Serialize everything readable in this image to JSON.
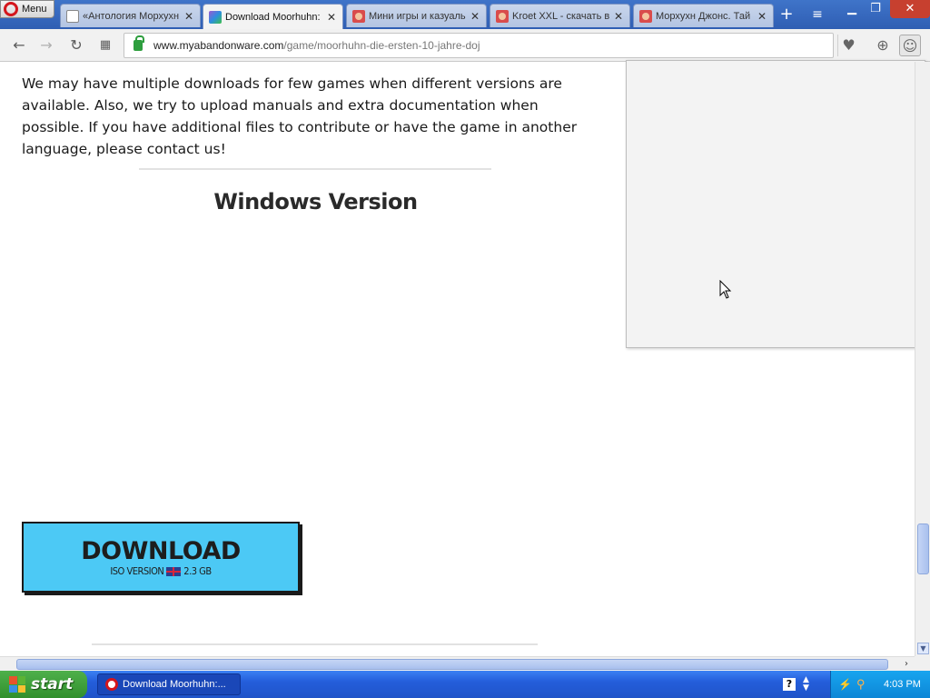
{
  "browser": {
    "menu_label": "Menu",
    "tabs": [
      {
        "title": "«Антология Морхухн",
        "icon": "document-icon",
        "active": false
      },
      {
        "title": "Download Moorhuhn:",
        "icon": "myabandonware-icon",
        "active": true
      },
      {
        "title": "Мини игры и казуаль",
        "icon": "moorhuhn-icon",
        "active": false
      },
      {
        "title": "Kroet XXL - скачать в",
        "icon": "moorhuhn-icon",
        "active": false
      },
      {
        "title": "Морхухн Джонс. Тай",
        "icon": "moorhuhn-icon",
        "active": false
      }
    ],
    "address": {
      "host": "www.myabandonware.com",
      "path": "/game/moorhuhn-die-ersten-10-jahre-doj"
    }
  },
  "page": {
    "intro_text": "We may have multiple downloads for few games when different versions are available. Also, we try to upload manuals and extra documentation when possible. If you have additional files to contribute or have the game in another language, please contact us!",
    "section_heading": "Windows Version",
    "download": {
      "label": "DOWNLOAD",
      "version_type": "ISO VERSION",
      "language_flag": "uk-flag-icon",
      "size": "2.3 GB"
    }
  },
  "taskbar": {
    "start_label": "start",
    "task_label": "Download Moorhuhn:...",
    "clock": "4:03 PM"
  },
  "colors": {
    "download_button": "#4cc9f5",
    "tab_strip": "#2f5eb3",
    "start_button": "#3a9a35"
  }
}
